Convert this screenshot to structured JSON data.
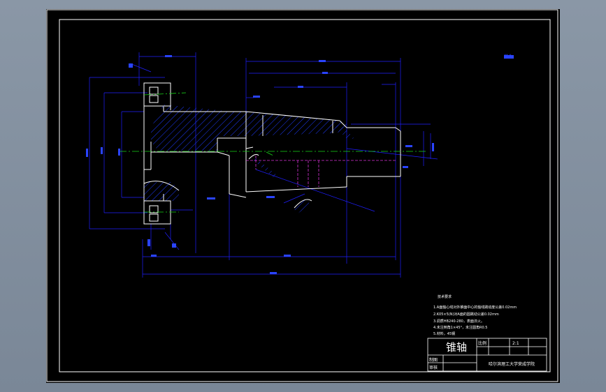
{
  "drawing": {
    "part_name": "锥轴",
    "scale_label": "比例",
    "scale_value": "2:1",
    "row_label_1": "制图",
    "row_label_2": "审核",
    "school": "哈尔滨理工大学荣成学院",
    "roughness_note": "其余",
    "tech_title": "技术要求",
    "tech_notes": [
      "1.A面轴心线对外锥面中心的轴线跳动度公差0.02mm",
      "2.K05×5(N)对A面的圆跳动公差0.02mm",
      "3.调质HB240-280，表面淬火。",
      "4.未注倒角1×45°，未注圆角R0.5",
      "5.材料，45钢"
    ]
  },
  "colors": {
    "outline": "#ffffff",
    "dimension": "#1f1fff",
    "hatch": "#1f3bff",
    "center_line": "#19d619",
    "hidden_line": "#d633d6",
    "frame": "#ffffff",
    "background": "#000000"
  }
}
